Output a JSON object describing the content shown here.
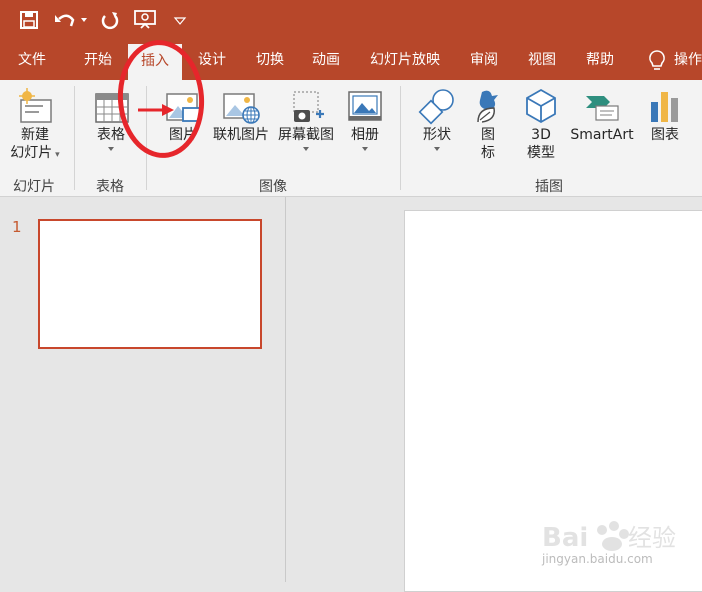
{
  "title_bar": {
    "quick_access": [
      "save-icon",
      "undo-icon",
      "redo-icon",
      "presentation-icon",
      "customize-icon"
    ]
  },
  "tabs": [
    {
      "label": "文件",
      "active": false
    },
    {
      "label": "开始",
      "active": false
    },
    {
      "label": "插入",
      "active": true
    },
    {
      "label": "设计",
      "active": false
    },
    {
      "label": "切换",
      "active": false
    },
    {
      "label": "动画",
      "active": false
    },
    {
      "label": "幻灯片放映",
      "active": false
    },
    {
      "label": "审阅",
      "active": false
    },
    {
      "label": "视图",
      "active": false
    },
    {
      "label": "帮助",
      "active": false
    }
  ],
  "tell_me": {
    "label": "操作",
    "icon": "lightbulb-icon"
  },
  "ribbon": {
    "groups": [
      {
        "label": "幻灯片",
        "buttons": [
          {
            "label": "新建",
            "label2": "幻灯片",
            "dropdown": true,
            "icon": "new-slide-icon"
          }
        ]
      },
      {
        "label": "表格",
        "buttons": [
          {
            "label": "表格",
            "dropdown": true,
            "icon": "table-icon"
          }
        ]
      },
      {
        "label": "图像",
        "buttons": [
          {
            "label": "图片",
            "icon": "picture-icon"
          },
          {
            "label": "联机图片",
            "icon": "online-picture-icon"
          },
          {
            "label": "屏幕截图",
            "dropdown": true,
            "icon": "screenshot-icon"
          },
          {
            "label": "相册",
            "dropdown": true,
            "icon": "photo-album-icon"
          }
        ]
      },
      {
        "label": "插图",
        "buttons": [
          {
            "label": "形状",
            "dropdown": true,
            "icon": "shapes-icon"
          },
          {
            "label": "图",
            "label2": "标",
            "icon": "icons-icon"
          },
          {
            "label": "3D",
            "label2": "模型",
            "icon": "3d-model-icon"
          },
          {
            "label": "SmartArt",
            "icon": "smartart-icon"
          },
          {
            "label": "图表",
            "icon": "chart-icon"
          }
        ]
      }
    ]
  },
  "slides": {
    "thumb_number": "1"
  },
  "watermark": {
    "text": "jingyan.baidu.com"
  },
  "colors": {
    "accent": "#b7472a",
    "annotation": "#e6262b"
  }
}
